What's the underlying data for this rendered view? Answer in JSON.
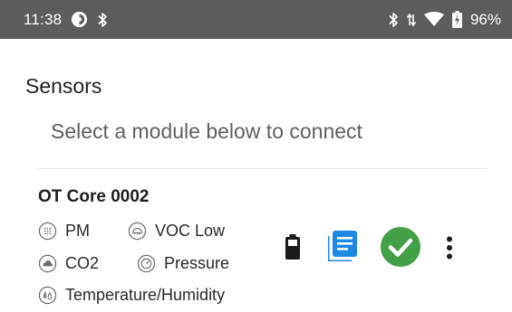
{
  "status_bar": {
    "time": "11:38",
    "battery_percent": "96%",
    "left_icons": [
      "circle-status-icon",
      "bluetooth-icon"
    ],
    "right_icons": [
      "bluetooth-icon",
      "data-arrows-icon",
      "wifi-icon",
      "battery-icon"
    ]
  },
  "page": {
    "title": "Sensors",
    "subtitle": "Select a module below to connect"
  },
  "device": {
    "name": "OT Core 0002",
    "sensors": [
      {
        "label": "PM",
        "icon": "pm-icon"
      },
      {
        "label": "VOC Low",
        "icon": "voc-icon"
      },
      {
        "label": "CO2",
        "icon": "cloud-icon"
      },
      {
        "label": "Pressure",
        "icon": "gauge-icon"
      },
      {
        "label": "Temperature/Humidity",
        "icon": "drops-icon"
      }
    ],
    "actions": [
      "battery-icon",
      "log-icon",
      "connected-check-icon",
      "more-vert-icon"
    ]
  },
  "colors": {
    "status_bar": "#5c5c5c",
    "log_icon": "#1e88e5",
    "check_icon": "#43a047",
    "text_primary": "#1f1f1f",
    "text_secondary": "#5f5f5f"
  }
}
